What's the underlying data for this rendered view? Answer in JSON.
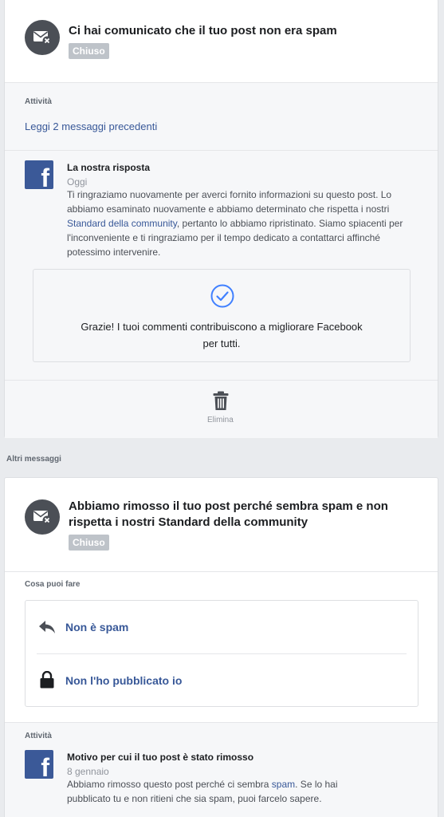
{
  "card1": {
    "title": "Ci hai comunicato che il tuo post non era spam",
    "status": "Chiuso",
    "activity_label": "Attività",
    "read_previous": "Leggi 2 messaggi precedenti",
    "reply": {
      "title": "La nostra risposta",
      "date": "Oggi",
      "body_1": "Ti ringraziamo nuovamente per averci fornito informazioni su questo post. Lo abbiamo esaminato nuovamente e abbiamo determinato che rispetta i nostri ",
      "body_link": "Standard della community",
      "body_2": ", pertanto lo abbiamo ripristinato. Siamo spiacenti per l'inconveniente e ti ringraziamo per il tempo dedicato a contattarci affinché potessimo intervenire."
    },
    "thanks_line1": "Grazie! I tuoi commenti contribuiscono a migliorare Facebook",
    "thanks_line2": "per tutti.",
    "delete_label": "Elimina"
  },
  "other_messages_label": "Altri messaggi",
  "card2": {
    "title_line1": "Abbiamo rimosso il tuo post perché sembra spam e non",
    "title_line2": "rispetta i nostri Standard della community",
    "status": "Chiuso",
    "what_you_can_do": "Cosa puoi fare",
    "actions": [
      {
        "label": "Non è spam",
        "icon": "reply-icon"
      },
      {
        "label": "Non l'ho pubblicato io",
        "icon": "lock-icon"
      }
    ],
    "activity_label": "Attività",
    "reason": {
      "title": "Motivo per cui il tuo post è stato rimosso",
      "date": "8 gennaio",
      "body_1": "Abbiamo rimosso questo post perché ci sembra ",
      "body_link": "spam",
      "body_2": ". Se lo hai pubblicato tu e non ritieni che sia spam, puoi farcelo sapere."
    }
  },
  "colors": {
    "link": "#385898",
    "facebook_blue": "#3b5998",
    "check_blue": "#4080ff",
    "badge_gray": "#bec3c9"
  }
}
